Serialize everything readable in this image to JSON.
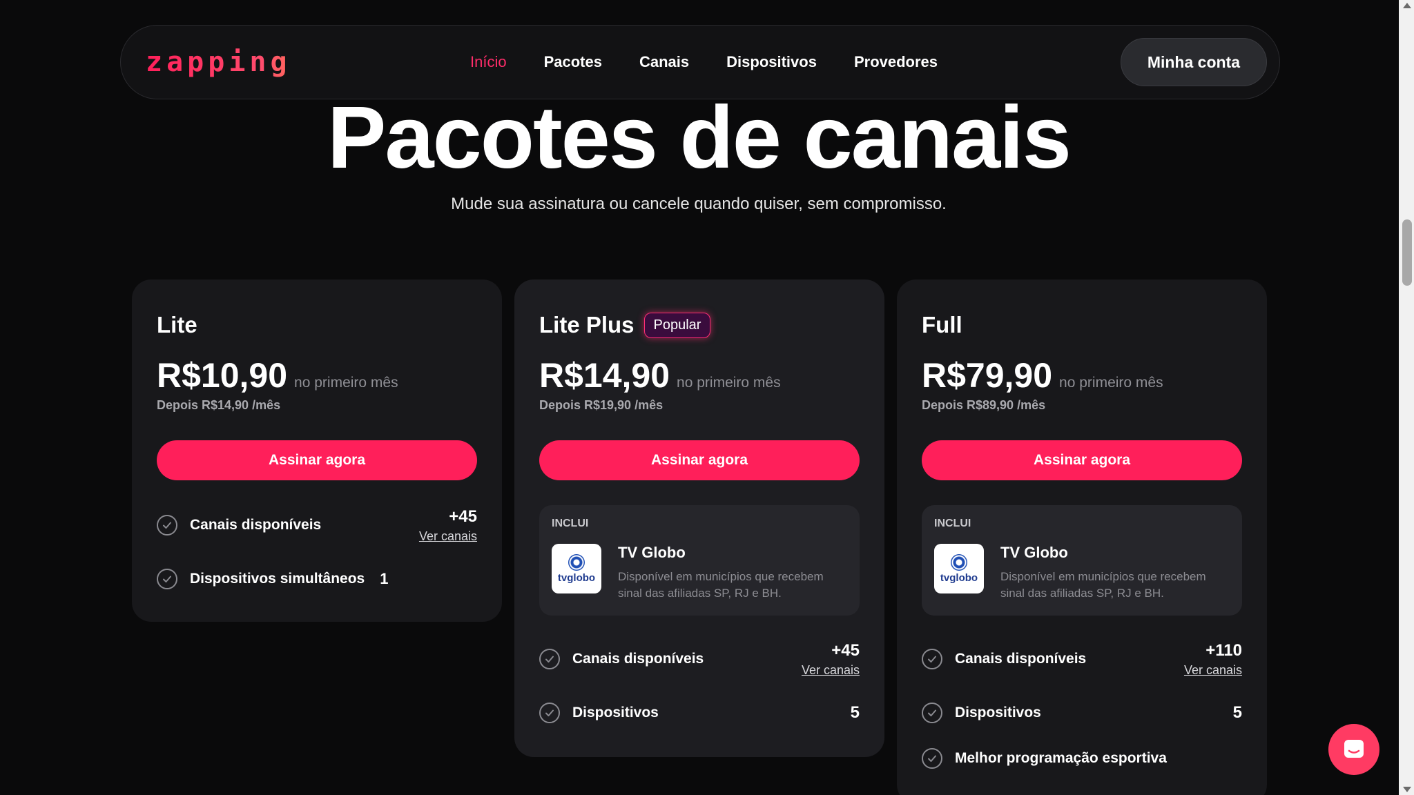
{
  "header": {
    "logo": "zapping",
    "nav": [
      {
        "label": "Início"
      },
      {
        "label": "Pacotes"
      },
      {
        "label": "Canais"
      },
      {
        "label": "Dispositivos"
      },
      {
        "label": "Provedores"
      }
    ],
    "account_label": "Minha conta"
  },
  "hero": {
    "title": "Pacotes de canais",
    "subtitle": "Mude  sua assinatura ou cancele quando quiser, sem compromisso."
  },
  "colors": {
    "accent": "#ff1f5a",
    "background": "#0a0a0b",
    "card": "#18181b"
  },
  "plans": [
    {
      "name": "Lite",
      "price": "R$10,90",
      "price_note": "no primeiro mês",
      "after": "Depois R$14,90 /mês",
      "cta": "Assinar agora",
      "features": [
        {
          "label": "Canais disponíveis",
          "count": "+45",
          "link": "Ver canais"
        },
        {
          "label": "Dispositivos simultâneos",
          "value": "1"
        }
      ]
    },
    {
      "name": "Lite Plus",
      "badge": "Popular",
      "price": "R$14,90",
      "price_note": "no primeiro mês",
      "after": "Depois R$19,90 /mês",
      "cta": "Assinar agora",
      "includes": {
        "label": "INCLUI",
        "logo_text": "tvglobo",
        "title": "TV Globo",
        "desc": "Disponível em municípios que recebem sinal das afiliadas SP, RJ e BH."
      },
      "features": [
        {
          "label": "Canais disponíveis",
          "count": "+45",
          "link": "Ver canais"
        },
        {
          "label": "Dispositivos",
          "value": "5"
        }
      ]
    },
    {
      "name": "Full",
      "price": "R$79,90",
      "price_note": "no primeiro mês",
      "after": "Depois R$89,90 /mês",
      "cta": "Assinar agora",
      "includes": {
        "label": "INCLUI",
        "logo_text": "tvglobo",
        "title": "TV Globo",
        "desc": "Disponível em municípios que recebem sinal das afiliadas SP, RJ e BH."
      },
      "features": [
        {
          "label": "Canais disponíveis",
          "count": "+110",
          "link": "Ver canais"
        },
        {
          "label": "Dispositivos",
          "value": "5"
        },
        {
          "label": "Melhor programação esportiva"
        }
      ]
    }
  ],
  "icons": {
    "check": "check-circle-icon",
    "chat": "chat-bubble-icon"
  }
}
